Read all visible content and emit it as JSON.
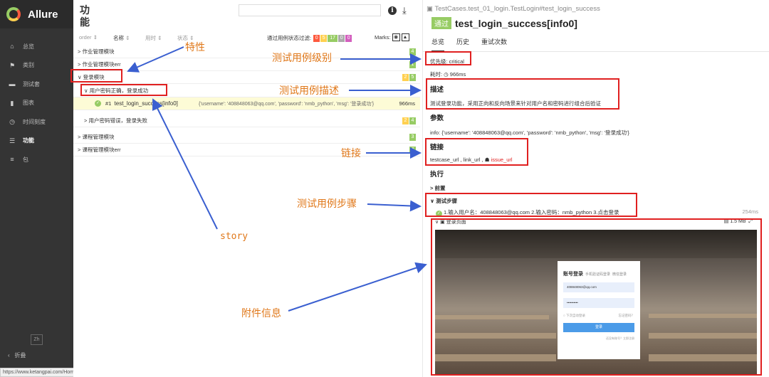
{
  "sidebar": {
    "app_name": "Allure",
    "items": [
      {
        "label": "总览",
        "icon": "home-icon",
        "glyph": "⌂"
      },
      {
        "label": "类别",
        "icon": "flag-icon",
        "glyph": "⚑"
      },
      {
        "label": "测试套",
        "icon": "briefcase-icon",
        "glyph": "▬"
      },
      {
        "label": "图表",
        "icon": "chart-icon",
        "glyph": "▮"
      },
      {
        "label": "时间刻度",
        "icon": "clock-icon",
        "glyph": "◷"
      },
      {
        "label": "功能",
        "icon": "list-icon",
        "glyph": "☰"
      },
      {
        "label": "包",
        "icon": "package-icon",
        "glyph": "≡"
      }
    ],
    "lang": "Zh",
    "collapse": "折叠"
  },
  "status_url": "https://www.ketangpai.com/Home/User/login.html",
  "tree": {
    "title": "功能",
    "headers": {
      "order": "order",
      "name": "名称",
      "time": "用时",
      "status": "状态"
    },
    "filter_label": "通过用例状态过滤:",
    "filter_counts": [
      "0",
      "5",
      "17",
      "0",
      "0"
    ],
    "marks_label": "Marks:",
    "rows": [
      {
        "label": "> 作业管理模块",
        "counts": [
          "4"
        ]
      },
      {
        "label": "> 作业管理模块err",
        "counts": [
          "1"
        ]
      },
      {
        "label": "∨ 登录模块",
        "counts": [
          "2",
          "5"
        ]
      },
      {
        "label": "∨ 用户密码正确，登录成功",
        "counts": []
      },
      {
        "num": "#1",
        "name": "test_login_success[info0]",
        "params": "{'username': '408848063@qq.com', 'password': 'nmb_python', 'msg': '登录成功'}",
        "time": "966ms"
      },
      {
        "label": "> 用户密码错误，登录失败",
        "counts": [
          "2",
          "4"
        ]
      },
      {
        "label": "> 课程管理模块",
        "counts": [
          "3"
        ]
      },
      {
        "label": "> 课程管理模块err",
        "counts": [
          "4"
        ]
      }
    ]
  },
  "annotations": {
    "feature": "特性",
    "story": "story",
    "severity": "测试用例级别",
    "description": "测试用例描述",
    "links": "链接",
    "steps": "测试用例步骤",
    "attachment": "附件信息"
  },
  "detail": {
    "path": "TestCases.test_01_login.TestLogin#test_login_success",
    "status": "通过",
    "title": "test_login_success[info0]",
    "tabs": [
      "总览",
      "历史",
      "重试次数"
    ],
    "severity": "优先级: critical",
    "duration": "耗时: ◷ 966ms",
    "desc_heading": "描述",
    "desc_text": "测试登录功能，采用正向和反向场景来针对用户名和密码进行组合后验证",
    "params_heading": "参数",
    "params_text": "info: {'username': '408848063@qq.com', 'password': 'nmb_python', 'msg': '登录成功'}",
    "links_heading": "链接",
    "link1": "testcase_url",
    "link2": "link_url",
    "link3": "issue_url",
    "exec_heading": "执行",
    "setup": "> 前置",
    "steps_heading": "∨ 测试步骤",
    "step_text": "1.输入用户名：408848063@qq.com 2.输入密码：nmb_python 3.点击登录",
    "step_time": "254ms",
    "attach_name": "∨ ▣ 登录页面",
    "attach_size": "▤ 1.5 MB",
    "login": {
      "title": "账号登录",
      "alt1": "手机验证码登录",
      "alt2": "微信登录",
      "user": "408848063@qq.com",
      "pwd": "••••••••••",
      "remember": "下次自动登录",
      "forgot": "忘记密码？",
      "btn": "登录",
      "foot": "还没有账号？立即注册"
    }
  }
}
